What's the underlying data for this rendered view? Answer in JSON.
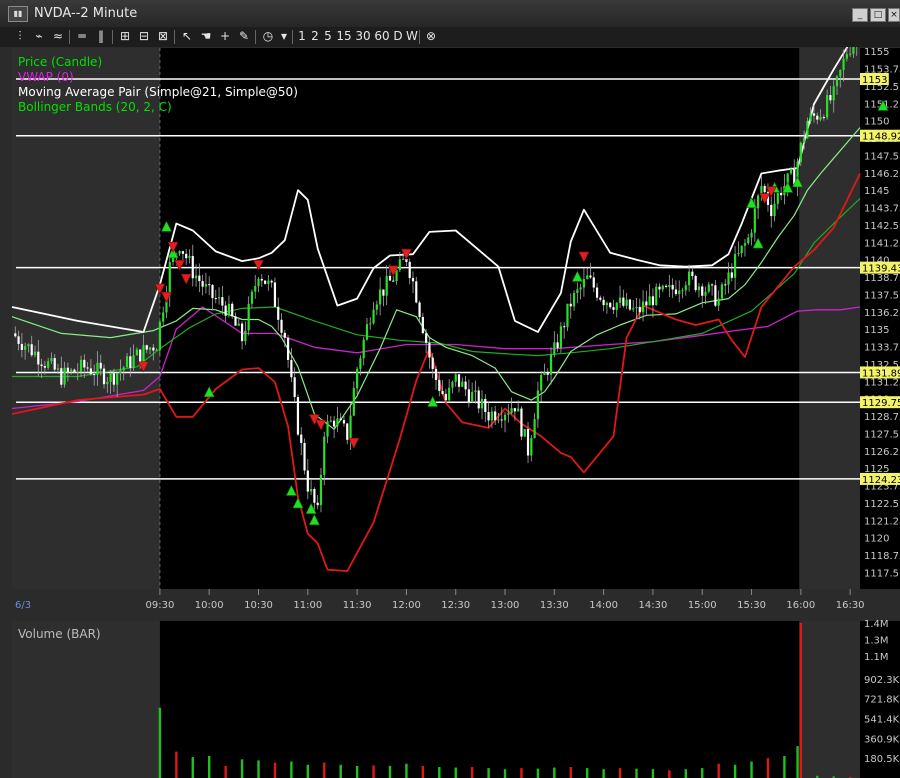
{
  "window": {
    "title": "NVDA--2 Minute",
    "icon": "chart-window-icon"
  },
  "toolbar": {
    "buttons": [
      {
        "name": "bar-chart-icon",
        "label": "⫶"
      },
      {
        "name": "draw-tools-icon",
        "label": "⌁"
      },
      {
        "name": "indicators-icon",
        "label": "≈"
      },
      {
        "name": "horizontal-line-icon",
        "label": "═"
      },
      {
        "name": "vertical-line-icon",
        "label": "‖"
      },
      {
        "name": "crosshair-box-icon",
        "label": "⊞"
      },
      {
        "name": "grid-icon",
        "label": "⊟"
      },
      {
        "name": "zoom-icon",
        "label": "⊠"
      },
      {
        "name": "cursor-icon",
        "label": "↖"
      },
      {
        "name": "hand-icon",
        "label": "☚"
      },
      {
        "name": "crosshair-icon",
        "label": "+"
      },
      {
        "name": "pencil-icon",
        "label": "✎"
      },
      {
        "name": "clock-icon",
        "label": "◷"
      }
    ],
    "intervals": [
      "1",
      "2",
      "5",
      "15",
      "30",
      "60",
      "D",
      "W"
    ],
    "close_icon": "⊗"
  },
  "chart_data": [
    {
      "type": "candlestick",
      "symbol": "NVDA",
      "interval": "2 Minute",
      "date_label": "6/3",
      "legend": [
        {
          "label": "Price (Candle)",
          "color": "#00e000"
        },
        {
          "label": "VWAP (0)",
          "color": "#e020e0"
        },
        {
          "label": "Moving Average Pair (Simple@21, Simple@50)",
          "color": "#ffffff"
        },
        {
          "label": "Bollinger Bands (20, 2, C)",
          "color": "#00e000"
        }
      ],
      "x_ticks": [
        "09:30",
        "10:00",
        "10:30",
        "11:00",
        "11:30",
        "12:00",
        "12:30",
        "13:00",
        "13:30",
        "14:00",
        "14:30",
        "15:00",
        "15:30",
        "16:00",
        "16:30"
      ],
      "y_ticks": [
        "1155",
        "1153.75",
        "1152.5",
        "1151.25",
        "1150",
        "1148.75",
        "1147.5",
        "1146.25",
        "1145",
        "1143.75",
        "1142.5",
        "1141.25",
        "1140",
        "1138.75",
        "1137.5",
        "1136.25",
        "1135",
        "1133.75",
        "1132.5",
        "1131.25",
        "1130",
        "1128.75",
        "1127.5",
        "1126.25",
        "1125",
        "1123.75",
        "1122.5",
        "1121.25",
        "1120",
        "1118.75",
        "1117.5"
      ],
      "ylim": [
        1116.6,
        1157.1
      ],
      "current_price": "1156.5",
      "horizontal_levels": [
        "1153",
        "1148.92",
        "1139.43",
        "1131.89",
        "1129.75",
        "1124.23"
      ],
      "time_range": [
        "08:00",
        "16:36"
      ],
      "regular_session": [
        "09:30",
        "15:59"
      ],
      "close_series": {
        "times": [
          "08:00",
          "08:15",
          "08:30",
          "08:45",
          "09:00",
          "09:15",
          "09:28",
          "09:36",
          "09:42",
          "09:50",
          "10:00",
          "10:10",
          "10:20",
          "10:30",
          "10:38",
          "10:46",
          "10:50",
          "10:56",
          "11:00",
          "11:06",
          "11:10",
          "11:16",
          "11:24",
          "11:30",
          "11:40",
          "11:50",
          "11:56",
          "12:00",
          "12:06",
          "12:16",
          "12:24",
          "12:30",
          "12:40",
          "12:50",
          "13:00",
          "13:06",
          "13:14",
          "13:20",
          "13:30",
          "13:40",
          "13:50",
          "14:00",
          "14:10",
          "14:20",
          "14:30",
          "14:40",
          "14:50",
          "15:00",
          "15:10",
          "15:20",
          "15:28",
          "15:36",
          "15:42",
          "15:48",
          "15:56",
          "16:04",
          "16:12",
          "16:20",
          "16:28",
          "16:36"
        ],
        "values": [
          1134.7,
          1133.2,
          1131.6,
          1132.3,
          1131.5,
          1133,
          1134,
          1139.5,
          1141.2,
          1139.2,
          1137.5,
          1136.6,
          1134.3,
          1139.2,
          1137.8,
          1134.6,
          1131,
          1126.5,
          1123.8,
          1121.7,
          1127.8,
          1128.5,
          1127.4,
          1132.2,
          1137.1,
          1138.4,
          1139.4,
          1140.2,
          1137.5,
          1131.9,
          1129.9,
          1131.4,
          1130.2,
          1128.9,
          1129.2,
          1129.6,
          1126.3,
          1130.5,
          1133.4,
          1136.9,
          1138.6,
          1137.2,
          1136.8,
          1136.2,
          1137.3,
          1137.7,
          1138.7,
          1138.1,
          1137.1,
          1139.8,
          1141.5,
          1145.3,
          1143.7,
          1145.1,
          1146.1,
          1150,
          1150.6,
          1151.8,
          1155,
          1156.5
        ]
      },
      "moving_average_fast": {
        "times": [
          "08:00",
          "08:30",
          "09:00",
          "09:26",
          "09:40",
          "09:50",
          "10:04",
          "10:20",
          "10:30",
          "10:38",
          "10:44",
          "10:54",
          "11:04",
          "11:16",
          "11:30",
          "11:44",
          "11:54",
          "12:06",
          "12:14",
          "12:24",
          "12:40",
          "12:54",
          "13:04",
          "13:16",
          "13:24",
          "13:30",
          "13:40",
          "13:56",
          "14:10",
          "14:26",
          "14:44",
          "15:00",
          "15:16",
          "15:26",
          "15:36",
          "15:46",
          "15:56",
          "16:04",
          "16:12",
          "16:20",
          "16:36"
        ],
        "values": [
          1135.9,
          1134.7,
          1134.4,
          1134.9,
          1135.6,
          1136.5,
          1136.4,
          1135.7,
          1135.7,
          1135.2,
          1134.4,
          1132.3,
          1128.9,
          1127.8,
          1130.2,
          1133.6,
          1136.4,
          1135.9,
          1134.4,
          1133.7,
          1133.1,
          1132.2,
          1130.5,
          1129.9,
          1130.5,
          1131.5,
          1133.4,
          1134.6,
          1135.3,
          1136,
          1136.1,
          1136.9,
          1137.2,
          1138.2,
          1139.8,
          1141.6,
          1143.2,
          1145,
          1146.2,
          1147.3,
          1149.5
        ]
      },
      "moving_average_slow": {
        "times": [
          "08:00",
          "08:40",
          "09:16",
          "09:30",
          "09:48",
          "10:04",
          "10:20",
          "10:40",
          "11:04",
          "11:30",
          "11:56",
          "12:20",
          "12:40",
          "13:04",
          "13:20",
          "13:40",
          "14:04",
          "14:30",
          "15:00",
          "15:30",
          "15:56",
          "16:08",
          "16:20",
          "16:36"
        ],
        "values": [
          1131.6,
          1131.6,
          1132.3,
          1133.6,
          1135.1,
          1136.1,
          1136.5,
          1136.6,
          1135.6,
          1134.6,
          1134.2,
          1134,
          1133.4,
          1133.2,
          1133.1,
          1133.3,
          1133.6,
          1134.1,
          1134.7,
          1136.3,
          1139,
          1141.2,
          1142.6,
          1144.4
        ]
      },
      "bollinger_upper": {
        "times": [
          "08:00",
          "08:40",
          "09:20",
          "09:30",
          "09:40",
          "09:50",
          "10:04",
          "10:20",
          "10:30",
          "10:38",
          "10:46",
          "10:54",
          "11:00",
          "11:06",
          "11:18",
          "11:30",
          "11:40",
          "11:50",
          "12:04",
          "12:14",
          "12:30",
          "12:40",
          "12:56",
          "13:06",
          "13:20",
          "13:34",
          "13:40",
          "13:48",
          "14:04",
          "14:20",
          "14:34",
          "14:50",
          "15:06",
          "15:16",
          "15:24",
          "15:36",
          "15:46",
          "15:58",
          "16:08",
          "16:20",
          "16:36"
        ],
        "values": [
          1136.6,
          1135.6,
          1134.8,
          1138.2,
          1142.6,
          1142.1,
          1140.6,
          1139.9,
          1140.1,
          1140.5,
          1141.4,
          1145,
          1144.3,
          1140.8,
          1136.7,
          1137.2,
          1139.4,
          1140.3,
          1140.4,
          1142,
          1142.1,
          1141.1,
          1139.5,
          1135.6,
          1134.8,
          1137.6,
          1141.3,
          1143.6,
          1140.5,
          1140,
          1139.6,
          1139.5,
          1139.6,
          1140.4,
          1142.6,
          1146.2,
          1146.4,
          1146.6,
          1151.2,
          1153.7,
          1156.8
        ]
      },
      "bollinger_lower": {
        "times": [
          "08:00",
          "08:40",
          "09:20",
          "09:30",
          "09:40",
          "09:50",
          "10:04",
          "10:20",
          "10:30",
          "10:40",
          "10:48",
          "10:54",
          "11:00",
          "11:06",
          "11:12",
          "11:24",
          "11:40",
          "11:56",
          "12:06",
          "12:14",
          "12:24",
          "12:34",
          "12:50",
          "13:00",
          "13:10",
          "13:22",
          "13:34",
          "13:40",
          "13:48",
          "14:06",
          "14:14",
          "14:24",
          "14:44",
          "14:56",
          "15:10",
          "15:18",
          "15:26",
          "15:36",
          "15:56",
          "16:08",
          "16:20",
          "16:36"
        ],
        "values": [
          1128.9,
          1129.9,
          1130.3,
          1130.7,
          1128.7,
          1128.7,
          1130.7,
          1132.1,
          1132.2,
          1131.2,
          1128,
          1122.9,
          1120.3,
          1119.6,
          1117.7,
          1117.6,
          1121.1,
          1127.1,
          1131.3,
          1133.6,
          1129.7,
          1128.3,
          1127.9,
          1129.3,
          1128.2,
          1127.3,
          1126.1,
          1125.8,
          1124.7,
          1127.3,
          1134.4,
          1136.7,
          1135.7,
          1135.3,
          1135.7,
          1134.2,
          1133,
          1136.6,
          1139.5,
          1140.7,
          1142.3,
          1146.2
        ]
      },
      "vwap": {
        "times": [
          "08:00",
          "08:40",
          "09:20",
          "09:30",
          "09:40",
          "09:56",
          "10:20",
          "10:40",
          "11:04",
          "11:30",
          "12:00",
          "12:30",
          "13:00",
          "13:30",
          "14:04",
          "14:30",
          "14:56",
          "15:20",
          "15:40",
          "15:58",
          "16:10",
          "16:24",
          "16:36"
        ],
        "values": [
          1129.3,
          1129.8,
          1130.6,
          1131.6,
          1135,
          1136.6,
          1134.7,
          1134.7,
          1133.7,
          1133.3,
          1133.9,
          1133.9,
          1133.6,
          1133.6,
          1133.9,
          1134.1,
          1134.5,
          1134.9,
          1135.2,
          1136.3,
          1136.4,
          1136.4,
          1136.6
        ]
      },
      "buy_signals": [
        {
          "time": "09:34",
          "price": 1142.4
        },
        {
          "time": "09:38",
          "price": 1140.5
        },
        {
          "time": "10:00",
          "price": 1130.5
        },
        {
          "time": "10:50",
          "price": 1123.4
        },
        {
          "time": "10:54",
          "price": 1122.5
        },
        {
          "time": "11:02",
          "price": 1122.1
        },
        {
          "time": "11:04",
          "price": 1121.3
        },
        {
          "time": "12:16",
          "price": 1129.8
        },
        {
          "time": "13:44",
          "price": 1138.8
        },
        {
          "time": "15:30",
          "price": 1144.1
        },
        {
          "time": "15:34",
          "price": 1141.2
        },
        {
          "time": "15:44",
          "price": 1145.2
        },
        {
          "time": "15:52",
          "price": 1145.2
        },
        {
          "time": "15:58",
          "price": 1145.6
        },
        {
          "time": "16:50",
          "price": 1151.1
        }
      ],
      "sell_signals": [
        {
          "time": "09:20",
          "price": 1132.3
        },
        {
          "time": "09:30",
          "price": 1137.9
        },
        {
          "time": "09:34",
          "price": 1137.3
        },
        {
          "time": "09:38",
          "price": 1140.9
        },
        {
          "time": "09:42",
          "price": 1139.6
        },
        {
          "time": "09:46",
          "price": 1138.6
        },
        {
          "time": "10:30",
          "price": 1139.6
        },
        {
          "time": "11:04",
          "price": 1128.5
        },
        {
          "time": "11:08",
          "price": 1128.1
        },
        {
          "time": "11:28",
          "price": 1126.8
        },
        {
          "time": "11:52",
          "price": 1139.2
        },
        {
          "time": "12:00",
          "price": 1140.4
        },
        {
          "time": "13:48",
          "price": 1140.2
        },
        {
          "time": "15:38",
          "price": 1144.4
        },
        {
          "time": "15:42",
          "price": 1144.9
        }
      ]
    },
    {
      "type": "bar",
      "title": "Volume (BAR)",
      "y_ticks": [
        "1.4M",
        "1.3M",
        "1.1M",
        "902.3K",
        "721.8K",
        "541.4K",
        "360.9K",
        "180.5K"
      ],
      "ylim": [
        0,
        1410000
      ],
      "time_range": [
        "08:00",
        "16:36"
      ],
      "bars": {
        "times": [
          "09:30",
          "09:40",
          "09:50",
          "10:00",
          "10:10",
          "10:20",
          "10:30",
          "10:40",
          "10:50",
          "11:00",
          "11:10",
          "11:20",
          "11:30",
          "11:40",
          "11:50",
          "12:00",
          "12:10",
          "12:20",
          "12:30",
          "12:40",
          "12:50",
          "13:00",
          "13:10",
          "13:20",
          "13:30",
          "13:40",
          "13:50",
          "14:00",
          "14:10",
          "14:20",
          "14:30",
          "14:40",
          "14:50",
          "15:00",
          "15:10",
          "15:20",
          "15:30",
          "15:40",
          "15:50",
          "15:58",
          "16:00",
          "16:10",
          "16:20",
          "16:30"
        ],
        "values": [
          640000,
          240000,
          190000,
          200000,
          110000,
          170000,
          160000,
          140000,
          150000,
          120000,
          140000,
          120000,
          110000,
          115000,
          110000,
          130000,
          110000,
          100000,
          95000,
          100000,
          90000,
          80000,
          90000,
          85000,
          95000,
          100000,
          90000,
          80000,
          90000,
          85000,
          80000,
          70000,
          80000,
          90000,
          130000,
          120000,
          150000,
          180000,
          200000,
          290000,
          1410000,
          20000,
          15000,
          10000
        ]
      }
    }
  ]
}
